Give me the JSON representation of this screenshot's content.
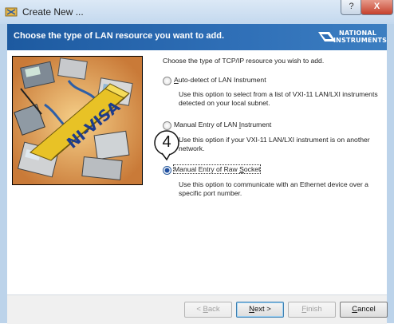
{
  "window": {
    "title": "Create New ...",
    "help_button": "?",
    "close_button": "X"
  },
  "header": {
    "title": "Choose the type of LAN resource you want to add.",
    "logo_line1": "NATIONAL",
    "logo_line2": "INSTRUMENTS"
  },
  "illustration": {
    "text": "NI-VISA"
  },
  "main": {
    "prompt": "Choose the type of TCP/IP resource you wish to add.",
    "options": [
      {
        "label_pre": "",
        "label_key": "A",
        "label_post": "uto-detect of LAN Instrument",
        "selected": false,
        "description": "Use this option to select from a list of VXI-11 LAN/LXI instruments detected on your local subnet."
      },
      {
        "label_pre": "Manual Entry of LAN ",
        "label_key": "I",
        "label_post": "nstrument",
        "selected": false,
        "description": "Use this option if your VXI-11 LAN/LXI instrument is on another network."
      },
      {
        "label_pre": "Manual Entry of Raw ",
        "label_key": "S",
        "label_post": "ocket",
        "selected": true,
        "description": "Use this option to communicate with an Ethernet device over a specific port number."
      }
    ]
  },
  "callout": {
    "number": "4"
  },
  "footer": {
    "back": {
      "pre": "< ",
      "key": "B",
      "post": "ack"
    },
    "next": {
      "pre": "",
      "key": "N",
      "post": "ext >"
    },
    "finish": {
      "pre": "",
      "key": "F",
      "post": "inish"
    },
    "cancel": {
      "pre": "",
      "key": "C",
      "post": "ancel"
    }
  }
}
